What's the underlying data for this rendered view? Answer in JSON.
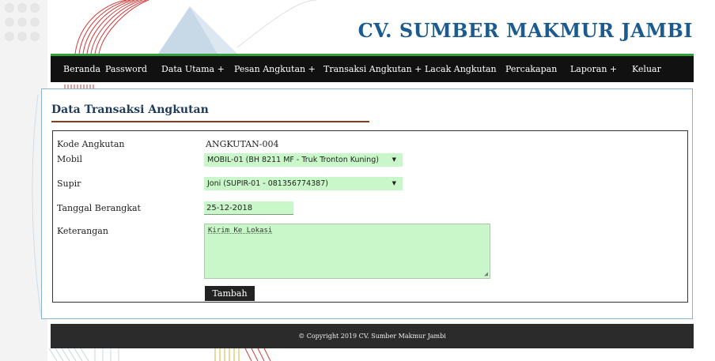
{
  "header": {
    "brand": "CV. SUMBER MAKMUR JAMBI"
  },
  "nav": {
    "items": [
      {
        "label": "Beranda"
      },
      {
        "label": "Password"
      },
      {
        "label": "Data Utama +"
      },
      {
        "label": "Pesan Angkutan +"
      },
      {
        "label": "Transaksi Angkutan +"
      },
      {
        "label": "Lacak Angkutan"
      },
      {
        "label": "Percakapan"
      },
      {
        "label": "Laporan +"
      },
      {
        "label": "Keluar"
      }
    ]
  },
  "panel": {
    "title": "Data Transaksi Angkutan"
  },
  "form": {
    "kode_label": "Kode Angkutan",
    "kode_value": "ANGKUTAN-004",
    "mobil_label": "Mobil",
    "mobil_value": "MOBIL-01 (BH 8211 MF - Truk Tronton Kuning)",
    "supir_label": "Supir",
    "supir_value": "Joni (SUPIR-01 - 081356774387)",
    "tanggal_label": "Tanggal Berangkat",
    "tanggal_value": "25-12-2018",
    "keterangan_label": "Keterangan",
    "keterangan_value": "Kirim Ke Lokasi",
    "submit_label": "Tambah"
  },
  "footer": {
    "copyright": "© Copyright 2019 CV. Sumber Makmur Jambi"
  },
  "colors": {
    "accent": "#1c5b8f",
    "nav_bg": "#111111",
    "nav_border": "#2fa03a",
    "input_bg": "#c9f7c9",
    "title_rule": "#8b3a1c"
  }
}
